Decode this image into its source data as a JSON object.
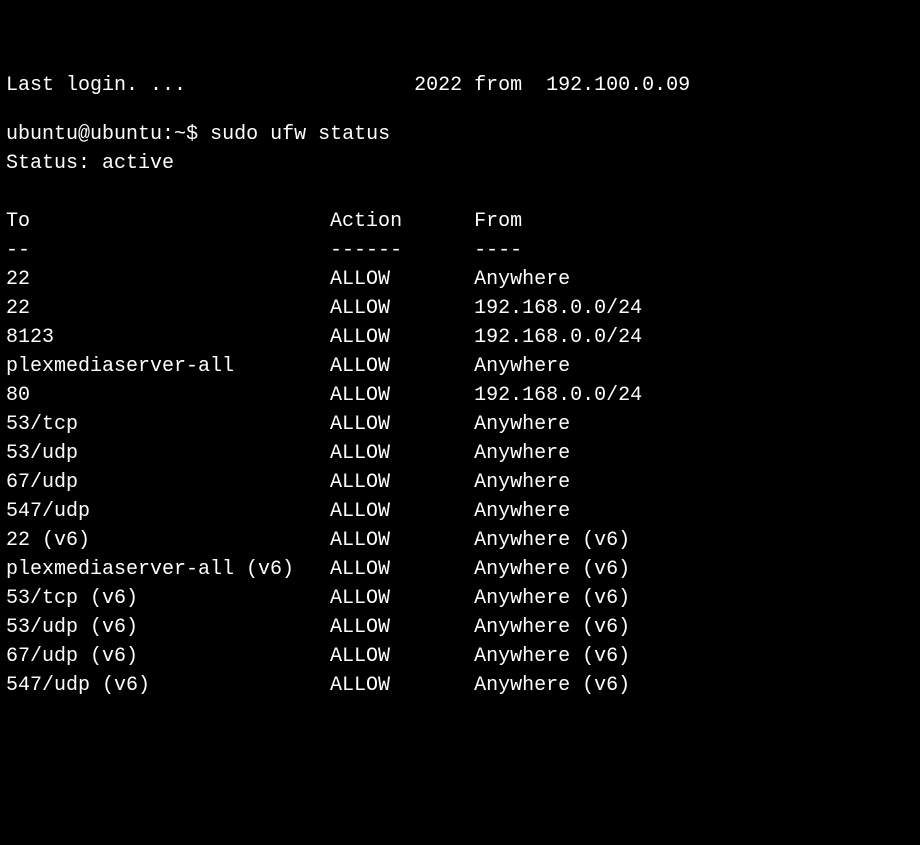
{
  "lastlogin_fragment": "Last login. ...                   2022 from  192.100.0.09",
  "prompt": {
    "userhost": "ubuntu@ubuntu",
    "path": "~",
    "symbol": "$",
    "command": "sudo ufw status"
  },
  "status_line": "Status: active",
  "columns": {
    "to_header": "To",
    "action_header": "Action",
    "from_header": "From",
    "to_sep": "--",
    "action_sep": "------",
    "from_sep": "----"
  },
  "rules": [
    {
      "to": "22",
      "action": "ALLOW",
      "from": "Anywhere"
    },
    {
      "to": "22",
      "action": "ALLOW",
      "from": "192.168.0.0/24"
    },
    {
      "to": "8123",
      "action": "ALLOW",
      "from": "192.168.0.0/24"
    },
    {
      "to": "plexmediaserver-all",
      "action": "ALLOW",
      "from": "Anywhere"
    },
    {
      "to": "80",
      "action": "ALLOW",
      "from": "192.168.0.0/24"
    },
    {
      "to": "53/tcp",
      "action": "ALLOW",
      "from": "Anywhere"
    },
    {
      "to": "53/udp",
      "action": "ALLOW",
      "from": "Anywhere"
    },
    {
      "to": "67/udp",
      "action": "ALLOW",
      "from": "Anywhere"
    },
    {
      "to": "547/udp",
      "action": "ALLOW",
      "from": "Anywhere"
    },
    {
      "to": "22 (v6)",
      "action": "ALLOW",
      "from": "Anywhere (v6)"
    },
    {
      "to": "plexmediaserver-all (v6)",
      "action": "ALLOW",
      "from": "Anywhere (v6)"
    },
    {
      "to": "53/tcp (v6)",
      "action": "ALLOW",
      "from": "Anywhere (v6)"
    },
    {
      "to": "53/udp (v6)",
      "action": "ALLOW",
      "from": "Anywhere (v6)"
    },
    {
      "to": "67/udp (v6)",
      "action": "ALLOW",
      "from": "Anywhere (v6)"
    },
    {
      "to": "547/udp (v6)",
      "action": "ALLOW",
      "from": "Anywhere (v6)"
    }
  ],
  "col_widths": {
    "to": 27,
    "action": 12
  }
}
